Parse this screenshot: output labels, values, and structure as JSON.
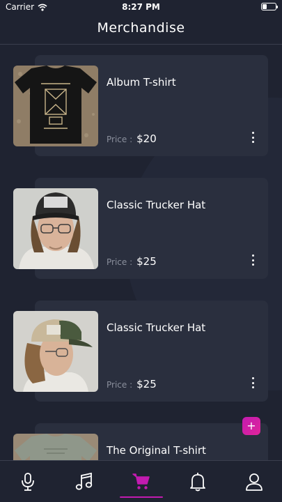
{
  "status_bar": {
    "carrier": "Carrier",
    "time": "8:27 PM",
    "battery_level": 0.35
  },
  "header": {
    "title": "Merchandise"
  },
  "products": [
    {
      "name": "Album T-shirt",
      "price_label": "Price :",
      "price": "$20",
      "thumbnail": "black-tshirt-photo"
    },
    {
      "name": "Classic Trucker Hat",
      "price_label": "Price :",
      "price": "$25",
      "thumbnail": "man-black-trucker-hat-photo"
    },
    {
      "name": "Classic Trucker Hat",
      "price_label": "Price :",
      "price": "$25",
      "thumbnail": "man-tan-trucker-hat-photo"
    },
    {
      "name": "The Original T-shirt",
      "price_label": "",
      "price": "",
      "thumbnail": "grey-tshirt-photo"
    }
  ],
  "add_button": {
    "label": "+"
  },
  "tab_bar": {
    "tabs": [
      {
        "icon": "microphone-icon",
        "active": false
      },
      {
        "icon": "music-note-icon",
        "active": false
      },
      {
        "icon": "cart-icon",
        "active": true
      },
      {
        "icon": "bell-icon",
        "active": false
      },
      {
        "icon": "user-icon",
        "active": false
      }
    ],
    "active_color": "#c21bb0",
    "inactive_color": "#ffffff"
  },
  "colors": {
    "background": "#1f2331",
    "card": "#2a2f3e",
    "accent": "#c21bb0",
    "muted_text": "#8a8f9c"
  }
}
